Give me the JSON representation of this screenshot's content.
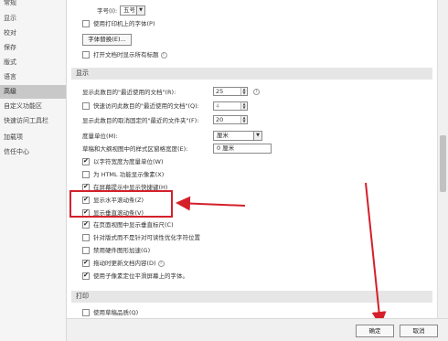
{
  "sidebar": {
    "items": [
      {
        "label": "常规"
      },
      {
        "label": "显示"
      },
      {
        "label": "校对"
      },
      {
        "label": "保存"
      },
      {
        "label": "版式"
      },
      {
        "label": "语言"
      },
      {
        "label": "高级",
        "active": true
      },
      {
        "label": "自定义功能区"
      },
      {
        "label": "快速访问工具栏"
      },
      {
        "label": "加载项"
      },
      {
        "label": "信任中心"
      }
    ]
  },
  "print_top": {
    "font_size_label": "字号(I):",
    "font_size_value": "五号",
    "use_printer_metrics_label": "使用打印机上的字体(P)",
    "font_substitution_button": "字体替换(E)...",
    "open_after_print_label": "打开文档时显示所有标题"
  },
  "display": {
    "header": "显示",
    "recent_docs_label": "显示此数目的\"最近使用的文档\"(R):",
    "recent_docs_value": "25",
    "quick_access_label": "快速访问此数目的\"最近使用的文档\"(Q):",
    "quick_access_value": "4",
    "unpinned_folders_label": "显示此数目的取消固定的\"最近的文件夹\"(F):",
    "unpinned_folders_value": "20",
    "units_label": "度量单位(M):",
    "units_value": "厘米",
    "style_area_label": "草稿和大纲视图中的样式区窗格宽度(E):",
    "style_area_value": "0 厘米",
    "char_width_units": "以字符宽度为度量单位(W)",
    "html_pixels": "为 HTML 功能显示像素(X)",
    "screentip_shortcuts": "在屏幕提示中显示快捷键(H)",
    "horizontal_scrollbar": "显示水平滚动条(Z)",
    "vertical_scrollbar": "显示垂直滚动条(V)",
    "vertical_ruler": "在页面视图中显示垂直标尺(C)",
    "optimize_layout": "针对版式而不是针对可读性优化字符位置",
    "disable_hw_accel": "禁用硬件图形加速(G)",
    "update_while_drag": "拖动时更新文档内容(D)",
    "subpixel_positioning": "使用子像素定位平滑屏幕上的字体。"
  },
  "print": {
    "header": "打印",
    "draft_quality": "使用草稿品质(Q)"
  },
  "footer": {
    "ok": "确定",
    "cancel": "取消"
  },
  "icons": {
    "info": "info-icon",
    "checkmark": "checkmark-icon",
    "spinner_arrows": "spinner-arrows-icon",
    "dropdown": "chevron-down-icon"
  },
  "colors": {
    "highlight_border": "#d4202a",
    "annotation_arrow": "#d4202a",
    "active_nav": "#c8c8c8"
  }
}
